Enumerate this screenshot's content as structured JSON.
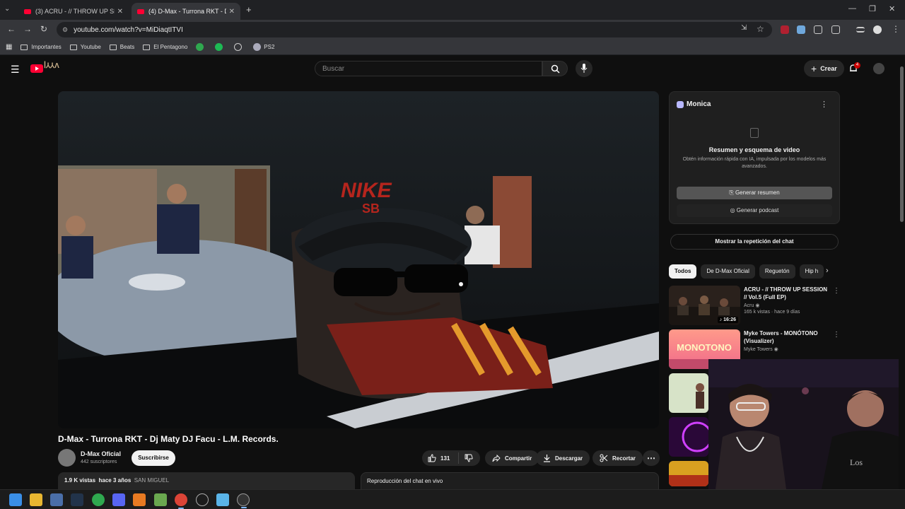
{
  "browser": {
    "tabs": [
      {
        "title": "(3) ACRU - // THROW UP SESSI",
        "active": false
      },
      {
        "title": "(4) D-Max - Turrona RKT - Dj M",
        "active": true
      }
    ],
    "url": "youtube.com/watch?v=MiDiaqtITVI",
    "bookmarks": [
      "Importantes",
      "Youtube",
      "Beats",
      "El Pentagono",
      "PS2"
    ]
  },
  "header": {
    "search_placeholder": "Buscar",
    "create_label": "Crear",
    "notif_count": "4"
  },
  "video": {
    "title": "D-Max - Turrona RKT - Dj Maty DJ Facu - L.M. Records.",
    "channel": "D-Max Oficial",
    "subscribers": "442 suscriptores",
    "subscribe_label": "Suscribirse",
    "likes": "131",
    "share_label": "Compartir",
    "download_label": "Descargar",
    "clip_label": "Recortar",
    "views": "1.9 K vistas",
    "age": "hace 3 años",
    "tag": "SAN MIGUEL",
    "live_chat_replay": "Reproducción del chat en vivo"
  },
  "monica": {
    "name": "Monica",
    "heading": "Resumen y esquema de video",
    "description": "Obtén información rápida con IA, impulsada por los modelos más avanzados.",
    "summary_btn": "Generar resumen",
    "podcast_btn": "Generar podcast"
  },
  "sidebar": {
    "show_chat_replay": "Mostrar la repetición del chat",
    "chips": [
      "Todos",
      "De D-Max Oficial",
      "Reguetón",
      "Hip h"
    ],
    "recommendations": [
      {
        "title": "ACRU - // THROW UP SESSION // Vol.5 (Full EP)",
        "channel": "Acru",
        "meta": "165 k vistas · hace 9 días",
        "duration": "16:26"
      },
      {
        "title": "Myke Towers - MONÓTONO (Visualizer)",
        "channel": "Myke Towers",
        "meta": "",
        "duration": ""
      }
    ]
  }
}
